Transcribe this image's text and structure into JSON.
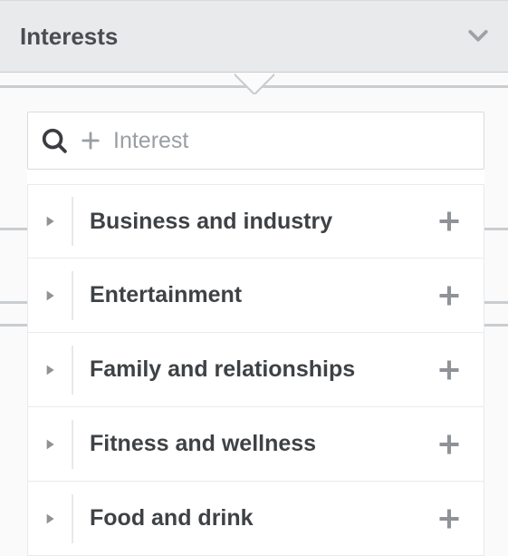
{
  "header": {
    "title": "Interests"
  },
  "search": {
    "placeholder": "Interest"
  },
  "categories": [
    {
      "label": "Business and industry"
    },
    {
      "label": "Entertainment"
    },
    {
      "label": "Family and relationships"
    },
    {
      "label": "Fitness and wellness"
    },
    {
      "label": "Food and drink"
    }
  ],
  "colors": {
    "icon_grey": "#8f9296",
    "text_dark": "#3f4245"
  }
}
